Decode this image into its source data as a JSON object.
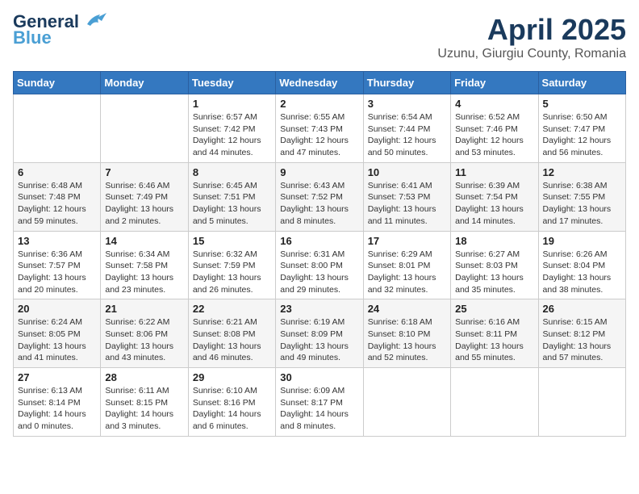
{
  "logo": {
    "line1": "General",
    "line1_blue": "Blue",
    "tagline": ""
  },
  "title": "April 2025",
  "subtitle": "Uzunu, Giurgiu County, Romania",
  "days_of_week": [
    "Sunday",
    "Monday",
    "Tuesday",
    "Wednesday",
    "Thursday",
    "Friday",
    "Saturday"
  ],
  "weeks": [
    [
      {
        "day": "",
        "info": ""
      },
      {
        "day": "",
        "info": ""
      },
      {
        "day": "1",
        "info": "Sunrise: 6:57 AM\nSunset: 7:42 PM\nDaylight: 12 hours and 44 minutes."
      },
      {
        "day": "2",
        "info": "Sunrise: 6:55 AM\nSunset: 7:43 PM\nDaylight: 12 hours and 47 minutes."
      },
      {
        "day": "3",
        "info": "Sunrise: 6:54 AM\nSunset: 7:44 PM\nDaylight: 12 hours and 50 minutes."
      },
      {
        "day": "4",
        "info": "Sunrise: 6:52 AM\nSunset: 7:46 PM\nDaylight: 12 hours and 53 minutes."
      },
      {
        "day": "5",
        "info": "Sunrise: 6:50 AM\nSunset: 7:47 PM\nDaylight: 12 hours and 56 minutes."
      }
    ],
    [
      {
        "day": "6",
        "info": "Sunrise: 6:48 AM\nSunset: 7:48 PM\nDaylight: 12 hours and 59 minutes."
      },
      {
        "day": "7",
        "info": "Sunrise: 6:46 AM\nSunset: 7:49 PM\nDaylight: 13 hours and 2 minutes."
      },
      {
        "day": "8",
        "info": "Sunrise: 6:45 AM\nSunset: 7:51 PM\nDaylight: 13 hours and 5 minutes."
      },
      {
        "day": "9",
        "info": "Sunrise: 6:43 AM\nSunset: 7:52 PM\nDaylight: 13 hours and 8 minutes."
      },
      {
        "day": "10",
        "info": "Sunrise: 6:41 AM\nSunset: 7:53 PM\nDaylight: 13 hours and 11 minutes."
      },
      {
        "day": "11",
        "info": "Sunrise: 6:39 AM\nSunset: 7:54 PM\nDaylight: 13 hours and 14 minutes."
      },
      {
        "day": "12",
        "info": "Sunrise: 6:38 AM\nSunset: 7:55 PM\nDaylight: 13 hours and 17 minutes."
      }
    ],
    [
      {
        "day": "13",
        "info": "Sunrise: 6:36 AM\nSunset: 7:57 PM\nDaylight: 13 hours and 20 minutes."
      },
      {
        "day": "14",
        "info": "Sunrise: 6:34 AM\nSunset: 7:58 PM\nDaylight: 13 hours and 23 minutes."
      },
      {
        "day": "15",
        "info": "Sunrise: 6:32 AM\nSunset: 7:59 PM\nDaylight: 13 hours and 26 minutes."
      },
      {
        "day": "16",
        "info": "Sunrise: 6:31 AM\nSunset: 8:00 PM\nDaylight: 13 hours and 29 minutes."
      },
      {
        "day": "17",
        "info": "Sunrise: 6:29 AM\nSunset: 8:01 PM\nDaylight: 13 hours and 32 minutes."
      },
      {
        "day": "18",
        "info": "Sunrise: 6:27 AM\nSunset: 8:03 PM\nDaylight: 13 hours and 35 minutes."
      },
      {
        "day": "19",
        "info": "Sunrise: 6:26 AM\nSunset: 8:04 PM\nDaylight: 13 hours and 38 minutes."
      }
    ],
    [
      {
        "day": "20",
        "info": "Sunrise: 6:24 AM\nSunset: 8:05 PM\nDaylight: 13 hours and 41 minutes."
      },
      {
        "day": "21",
        "info": "Sunrise: 6:22 AM\nSunset: 8:06 PM\nDaylight: 13 hours and 43 minutes."
      },
      {
        "day": "22",
        "info": "Sunrise: 6:21 AM\nSunset: 8:08 PM\nDaylight: 13 hours and 46 minutes."
      },
      {
        "day": "23",
        "info": "Sunrise: 6:19 AM\nSunset: 8:09 PM\nDaylight: 13 hours and 49 minutes."
      },
      {
        "day": "24",
        "info": "Sunrise: 6:18 AM\nSunset: 8:10 PM\nDaylight: 13 hours and 52 minutes."
      },
      {
        "day": "25",
        "info": "Sunrise: 6:16 AM\nSunset: 8:11 PM\nDaylight: 13 hours and 55 minutes."
      },
      {
        "day": "26",
        "info": "Sunrise: 6:15 AM\nSunset: 8:12 PM\nDaylight: 13 hours and 57 minutes."
      }
    ],
    [
      {
        "day": "27",
        "info": "Sunrise: 6:13 AM\nSunset: 8:14 PM\nDaylight: 14 hours and 0 minutes."
      },
      {
        "day": "28",
        "info": "Sunrise: 6:11 AM\nSunset: 8:15 PM\nDaylight: 14 hours and 3 minutes."
      },
      {
        "day": "29",
        "info": "Sunrise: 6:10 AM\nSunset: 8:16 PM\nDaylight: 14 hours and 6 minutes."
      },
      {
        "day": "30",
        "info": "Sunrise: 6:09 AM\nSunset: 8:17 PM\nDaylight: 14 hours and 8 minutes."
      },
      {
        "day": "",
        "info": ""
      },
      {
        "day": "",
        "info": ""
      },
      {
        "day": "",
        "info": ""
      }
    ]
  ]
}
